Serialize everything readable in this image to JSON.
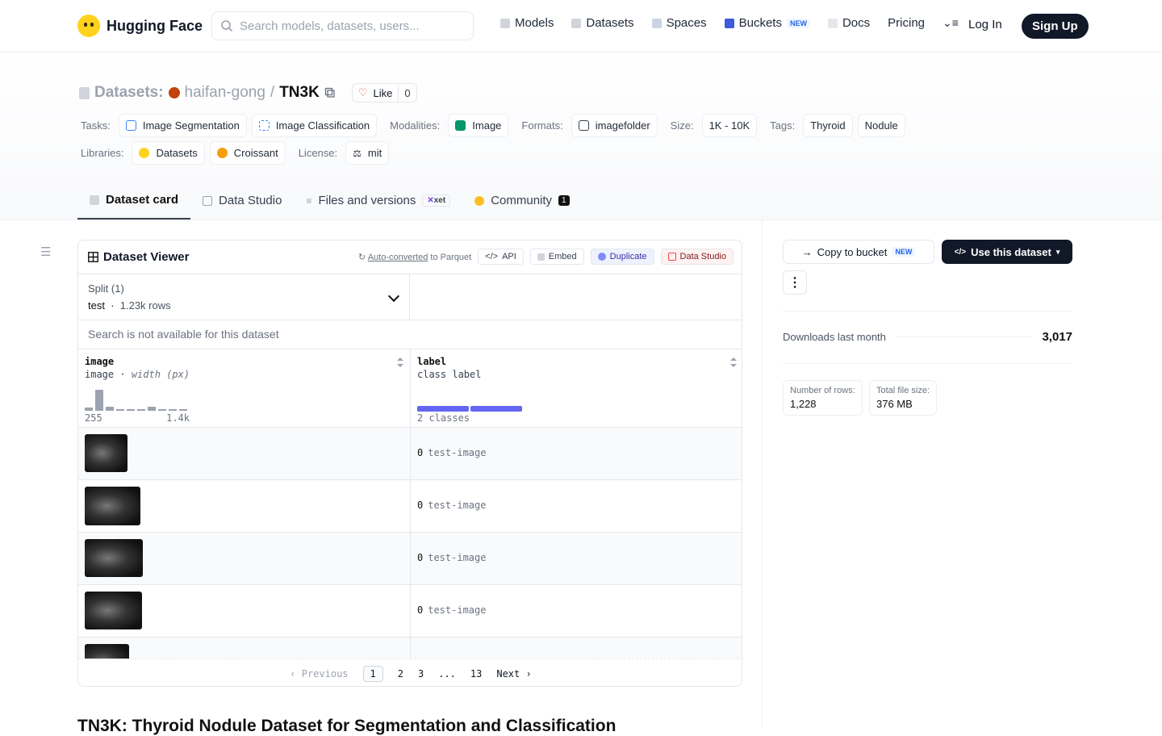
{
  "nav": {
    "brand": "Hugging Face",
    "search_placeholder": "Search models, datasets, users...",
    "links": [
      "Models",
      "Datasets",
      "Spaces",
      "Buckets",
      "Docs",
      "Pricing"
    ],
    "buckets_badge": "NEW",
    "login": "Log In",
    "signup": "Sign Up"
  },
  "header": {
    "section": "Datasets:",
    "owner": "haifan-gong",
    "sep": "/",
    "name": "TN3K",
    "like_label": "Like",
    "like_count": "0",
    "tasks_label": "Tasks:",
    "tasks": [
      "Image Segmentation",
      "Image Classification"
    ],
    "modalities_label": "Modalities:",
    "modality": "Image",
    "formats_label": "Formats:",
    "format": "imagefolder",
    "size_label": "Size:",
    "size": "1K - 10K",
    "tags_label": "Tags:",
    "tags": [
      "Thyroid",
      "Nodule"
    ],
    "libraries_label": "Libraries:",
    "libraries": [
      "Datasets",
      "Croissant"
    ],
    "license_label": "License:",
    "license": "mit"
  },
  "tabs": {
    "dataset_card": "Dataset card",
    "data_studio": "Data Studio",
    "files": "Files and versions",
    "xet": "xet",
    "community": "Community",
    "community_count": "1"
  },
  "viewer": {
    "title": "Dataset Viewer",
    "auto": "Auto-converted",
    "auto_suffix": "to Parquet",
    "api": "API",
    "embed": "Embed",
    "duplicate": "Duplicate",
    "data_studio": "Data Studio",
    "split_label": "Split (1)",
    "split_name": "test",
    "split_rows": "1.23k rows",
    "search_na": "Search is not available for this dataset",
    "col1_name": "image",
    "col1_type": "image",
    "col1_sub": "width (px)",
    "col1_min": "255",
    "col1_max": "1.4k",
    "col2_name": "label",
    "col2_type": "class label",
    "col2_classes": "2 classes",
    "rows": [
      {
        "label_id": "0",
        "label": "test-image"
      },
      {
        "label_id": "0",
        "label": "test-image"
      },
      {
        "label_id": "0",
        "label": "test-image"
      },
      {
        "label_id": "0",
        "label": "test-image"
      }
    ],
    "pager": {
      "prev": "Previous",
      "p1": "1",
      "p2": "2",
      "p3": "3",
      "ellipsis": "...",
      "last": "13",
      "next": "Next"
    }
  },
  "sidebar": {
    "copy": "Copy to bucket",
    "copy_badge": "NEW",
    "use": "Use this dataset",
    "downloads_label": "Downloads last month",
    "downloads": "3,017",
    "rows_label": "Number of rows:",
    "rows_value": "1,228",
    "size_label": "Total file size:",
    "size_value": "376 MB"
  },
  "card_title": "TN3K: Thyroid Nodule Dataset for Segmentation and Classification"
}
